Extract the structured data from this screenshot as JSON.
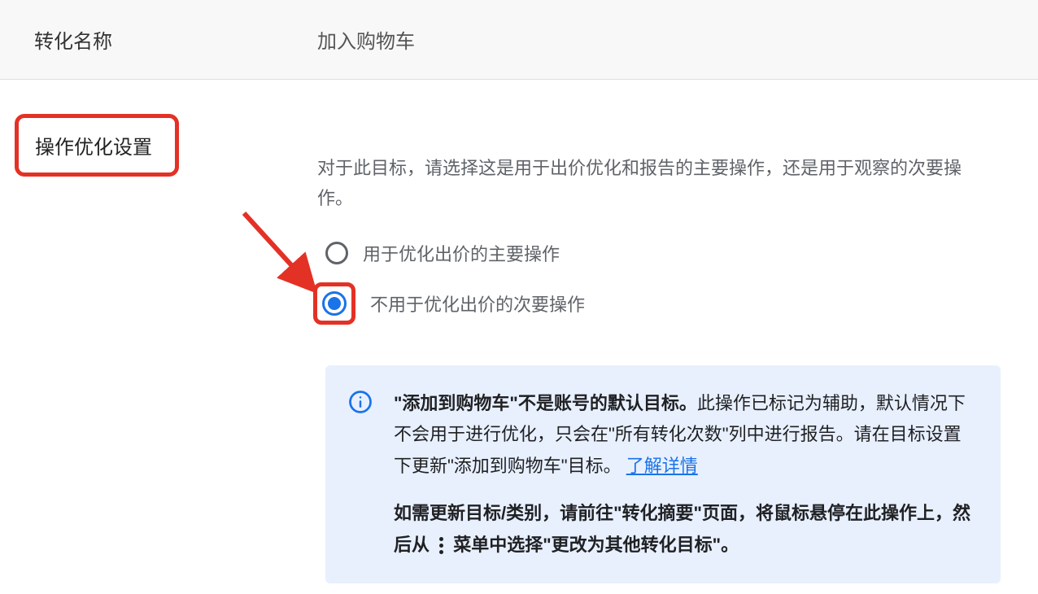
{
  "header": {
    "label": "转化名称",
    "value": "加入购物车"
  },
  "section": {
    "title": "操作优化设置",
    "description": "对于此目标，请选择这是用于出价优化和报告的主要操作，还是用于观察的次要操作。",
    "options": {
      "primary": "用于优化出价的主要操作",
      "secondary": "不用于优化出价的次要操作"
    },
    "info": {
      "p1_bold": "\"添加到购物车\"不是账号的默认目标。",
      "p1_rest": "此操作已标记为辅助，默认情况下不会用于进行优化，只会在\"所有转化次数\"列中进行报告。请在目标设置下更新\"添加到购物车\"目标。",
      "p1_link": "了解详情",
      "p2_a": "如需更新目标/类别，请前往\"转化摘要\"页面，将鼠标悬停在此操作上，然后从 ",
      "p2_b": " 菜单中选择\"更改为其他转化目标\"。"
    }
  }
}
